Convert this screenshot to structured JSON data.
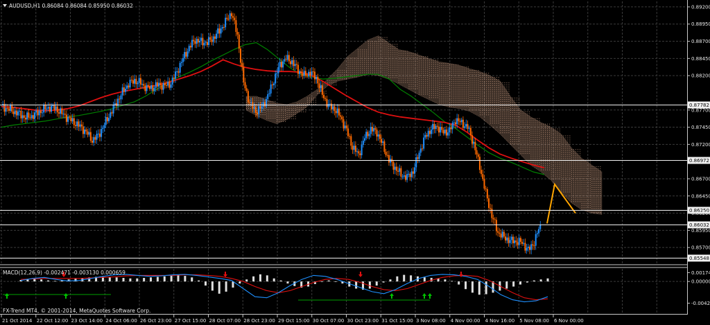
{
  "window": {
    "symbol_title": "AUDUSD,H1  0.86084 0.86084 0.85950 0.86032",
    "indicator_title": "MACD(12,26,9) -0.002471 -0.003130 0.000659",
    "copyright": "FX-Trend MT4, © 2001-2014, MetaQuotes Software Corp."
  },
  "colors": {
    "background": "#000000",
    "grid": "#3a3a3a",
    "bull_candle": "#1e90ff",
    "bear_candle": "#ff6a00",
    "ma_fast": "#008000",
    "ma_slow": "#e01010",
    "cloud": "#d4a58a",
    "projection": "#ffa500",
    "macd_hist": "#e0e0e0",
    "macd_line": "#1e90ff",
    "signal_line": "#e01010",
    "arrow_up": "#00c000"
  },
  "chart_data": [
    {
      "type": "candlestick",
      "symbol": "AUDUSD",
      "timeframe": "H1",
      "x_tick_labels": [
        "21 Oct 2014",
        "22 Oct 12:00",
        "23 Oct 14:00",
        "24 Oct 06:00",
        "26 Oct 23:00",
        "27 Oct 15:00",
        "28 Oct 07:00",
        "28 Oct 23:00",
        "29 Oct 15:00",
        "30 Oct 07:00",
        "30 Oct 23:00",
        "31 Oct 15:00",
        "3 Nov 08:00",
        "4 Nov 00:00",
        "4 Nov 16:00",
        "5 Nov 08:00",
        "6 Nov 00:00"
      ],
      "y_ticks": [
        "0.89200",
        "0.88950",
        "0.88700",
        "0.88450",
        "0.88200",
        "0.87700",
        "0.87450",
        "0.87200",
        "0.86700",
        "0.86450",
        "0.86200",
        "0.85950",
        "0.85700"
      ],
      "ylim": [
        0.8547,
        0.8928
      ],
      "horizontal_levels": [
        "0.87782",
        "0.86972",
        "0.86250",
        "0.86032",
        "0.85548"
      ],
      "close_series": [
        0.8775,
        0.8772,
        0.8768,
        0.8764,
        0.8759,
        0.8761,
        0.8766,
        0.8771,
        0.8774,
        0.8772,
        0.8765,
        0.8758,
        0.8752,
        0.8746,
        0.8738,
        0.8726,
        0.8733,
        0.8749,
        0.8765,
        0.8781,
        0.8796,
        0.8808,
        0.8813,
        0.8809,
        0.8802,
        0.8803,
        0.8807,
        0.8805,
        0.8809,
        0.8826,
        0.8845,
        0.8861,
        0.8872,
        0.8869,
        0.8868,
        0.8875,
        0.8885,
        0.8898,
        0.8912,
        0.8878,
        0.881,
        0.878,
        0.8768,
        0.8774,
        0.879,
        0.8814,
        0.8836,
        0.8845,
        0.884,
        0.8828,
        0.882,
        0.8825,
        0.8817,
        0.8793,
        0.8776,
        0.8772,
        0.876,
        0.874,
        0.8716,
        0.8705,
        0.873,
        0.8742,
        0.8738,
        0.8718,
        0.8697,
        0.8686,
        0.8676,
        0.8672,
        0.8681,
        0.8708,
        0.8731,
        0.8743,
        0.8746,
        0.8737,
        0.874,
        0.8756,
        0.8751,
        0.8745,
        0.8721,
        0.8688,
        0.8649,
        0.8616,
        0.8592,
        0.8585,
        0.858,
        0.8579,
        0.8577,
        0.8566,
        0.8578,
        0.8603
      ],
      "series": [
        {
          "name": "",
          "kind": "ma_fast",
          "values": [
            0.8745,
            0.8748,
            0.875,
            0.8752,
            0.8754,
            0.8757,
            0.876,
            0.8762,
            0.8765,
            0.8768,
            0.8772,
            0.8777,
            0.8782,
            0.879,
            0.88,
            0.881,
            0.8818,
            0.8825,
            0.8833,
            0.8842,
            0.885,
            0.8858,
            0.8865,
            0.8868,
            0.8858,
            0.8845,
            0.8832,
            0.8822,
            0.8818,
            0.8815,
            0.8816,
            0.8818,
            0.882,
            0.8822,
            0.8822,
            0.8815,
            0.88,
            0.879,
            0.8778,
            0.8766,
            0.8753,
            0.8743,
            0.8731,
            0.8719,
            0.8708,
            0.87,
            0.8694,
            0.8687,
            0.868,
            0.8676
          ]
        },
        {
          "name": "",
          "kind": "ma_slow",
          "values": [
            0.8775,
            0.8774,
            0.8772,
            0.877,
            0.8769,
            0.877,
            0.8772,
            0.8776,
            0.8782,
            0.8788,
            0.8793,
            0.8797,
            0.88,
            0.8803,
            0.8806,
            0.881,
            0.8815,
            0.882,
            0.8826,
            0.8834,
            0.8843,
            0.8837,
            0.8832,
            0.8829,
            0.8827,
            0.8826,
            0.8826,
            0.8825,
            0.882,
            0.8812,
            0.8802,
            0.8792,
            0.8783,
            0.8774,
            0.8767,
            0.8763,
            0.876,
            0.8758,
            0.8756,
            0.8754,
            0.8752,
            0.8748,
            0.8738,
            0.8726,
            0.8715,
            0.8706,
            0.87,
            0.8695,
            0.869,
            0.8686
          ]
        },
        {
          "name": "",
          "kind": "projection",
          "values": [
            0.8605,
            0.8662,
            0.862
          ]
        }
      ],
      "cloud_upper": [
        0.879,
        0.879,
        0.8785,
        0.878,
        0.8778,
        0.8782,
        0.879,
        0.88,
        0.8815,
        0.883,
        0.8848,
        0.886,
        0.8872,
        0.8878,
        0.8868,
        0.8858,
        0.8855,
        0.885,
        0.8845,
        0.884,
        0.8838,
        0.8835,
        0.883,
        0.8826,
        0.882,
        0.8812,
        0.879,
        0.877,
        0.876,
        0.8752,
        0.8745,
        0.8735,
        0.8715,
        0.87,
        0.869,
        0.868
      ],
      "cloud_lower": [
        0.877,
        0.8762,
        0.8755,
        0.875,
        0.8756,
        0.8765,
        0.8775,
        0.8792,
        0.8805,
        0.8812,
        0.8815,
        0.8818,
        0.8822,
        0.882,
        0.8815,
        0.8808,
        0.88,
        0.8792,
        0.8785,
        0.8778,
        0.8774,
        0.8772,
        0.8768,
        0.876,
        0.8748,
        0.8735,
        0.872,
        0.8705,
        0.869,
        0.868,
        0.8668,
        0.865,
        0.8635,
        0.8625,
        0.862,
        0.8618
      ]
    },
    {
      "type": "macd",
      "title": "MACD(12,26,9) -0.002471 -0.003130 0.000659",
      "y_ticks": [
        "0.00174",
        "0.00000",
        "-0.004262"
      ],
      "ylim": [
        -0.0046,
        0.0022
      ],
      "histogram": [
        0.0003,
        0.0005,
        0.0006,
        0.0004,
        0.0002,
        0.0001,
        0.0002,
        0.0004,
        0.0006,
        0.0007,
        0.0008,
        0.0009,
        0.0009,
        0.0008,
        0.0008,
        0.0007,
        0.0006,
        0.0006,
        0.0007,
        0.0008,
        0.0009,
        0.001,
        0.0011,
        0.0012,
        0.0011,
        0.0008,
        0.0002,
        -0.0008,
        -0.0018,
        -0.0024,
        -0.002,
        -0.0012,
        -0.0004,
        0.0004,
        0.001,
        0.0014,
        0.0012,
        0.0006,
        0.0002,
        -0.0004,
        -0.0009,
        -0.0012,
        -0.001,
        -0.0005,
        0.0,
        0.0002,
        0.0,
        -0.0004,
        -0.001,
        -0.0014,
        -0.0016,
        -0.0014,
        -0.0008,
        -0.0002,
        0.0004,
        0.001,
        0.0013,
        0.0012,
        0.001,
        0.0008,
        0.0007,
        0.0006,
        0.0004,
        0.0001,
        -0.0006,
        -0.0015,
        -0.0022,
        -0.0026,
        -0.0025,
        -0.0022,
        -0.0018,
        -0.0014,
        -0.001,
        -0.0006,
        -0.0002,
        0.0002,
        0.0004,
        0.0006
      ],
      "macd_line": [
        0.0002,
        0.0006,
        0.0008,
        0.0004,
        0.0001,
        0.0002,
        0.0006,
        0.001,
        0.0013,
        0.0014,
        0.0012,
        0.001,
        0.0011,
        0.0013,
        0.0014,
        0.0012,
        0.0009,
        0.0006,
        0.0002,
        -0.0014,
        -0.003,
        -0.0032,
        -0.0022,
        -0.0008,
        0.0004,
        0.0012,
        0.001,
        0.0004,
        -0.0004,
        -0.0012,
        -0.002,
        -0.0024,
        -0.0016,
        -0.0004,
        0.0006,
        0.0012,
        0.0014,
        0.0013,
        0.001,
        0.0004,
        -0.001,
        -0.0026,
        -0.0036,
        -0.004,
        -0.0038,
        -0.003
      ],
      "signal_line": [
        0.0004,
        0.0005,
        0.0006,
        0.0006,
        0.0006,
        0.0006,
        0.0007,
        0.0008,
        0.0009,
        0.0011,
        0.0012,
        0.0012,
        0.0012,
        0.0012,
        0.0013,
        0.0013,
        0.0012,
        0.001,
        0.0006,
        0.0,
        -0.001,
        -0.0018,
        -0.0022,
        -0.0018,
        -0.001,
        -0.0002,
        0.0004,
        0.0006,
        0.0004,
        -0.0002,
        -0.001,
        -0.0016,
        -0.0018,
        -0.0014,
        -0.0006,
        0.0002,
        0.0008,
        0.0011,
        0.0012,
        0.001,
        0.0002,
        -0.001,
        -0.0022,
        -0.0032,
        -0.0036,
        -0.0034
      ]
    }
  ]
}
